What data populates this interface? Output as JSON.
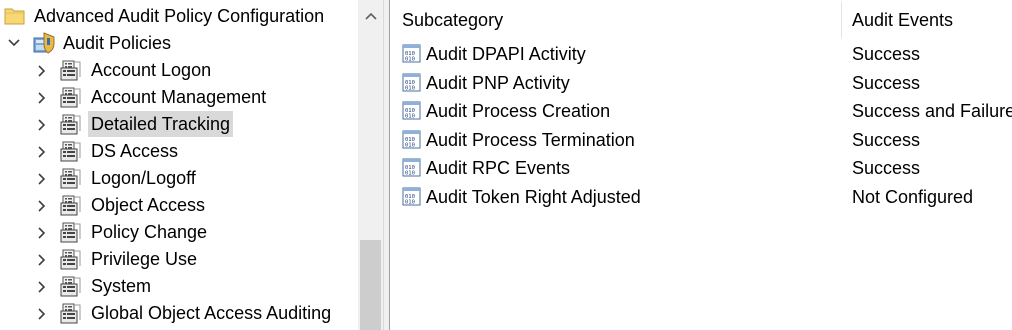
{
  "tree": {
    "root": {
      "label": "Advanced Audit Policy Configuration",
      "icon": "folder-icon"
    },
    "audit_policies": {
      "label": "Audit Policies",
      "icon": "audit-policy-icon",
      "expanded": true
    },
    "items": [
      {
        "label": "Account Logon",
        "icon": "policy-category-icon",
        "selected": false
      },
      {
        "label": "Account Management",
        "icon": "policy-category-icon",
        "selected": false
      },
      {
        "label": "Detailed Tracking",
        "icon": "policy-category-icon",
        "selected": true
      },
      {
        "label": "DS Access",
        "icon": "policy-category-icon",
        "selected": false
      },
      {
        "label": "Logon/Logoff",
        "icon": "policy-category-icon",
        "selected": false
      },
      {
        "label": "Object Access",
        "icon": "policy-category-icon",
        "selected": false
      },
      {
        "label": "Policy Change",
        "icon": "policy-category-icon",
        "selected": false
      },
      {
        "label": "Privilege Use",
        "icon": "policy-category-icon",
        "selected": false
      },
      {
        "label": "System",
        "icon": "policy-category-icon",
        "selected": false
      },
      {
        "label": "Global Object Access Auditing",
        "icon": "policy-category-icon",
        "selected": false
      }
    ]
  },
  "list": {
    "columns": {
      "subcategory": "Subcategory",
      "audit_events": "Audit Events"
    },
    "rows": [
      {
        "name": "Audit DPAPI Activity",
        "value": "Success"
      },
      {
        "name": "Audit PNP Activity",
        "value": "Success"
      },
      {
        "name": "Audit Process Creation",
        "value": "Success and Failure"
      },
      {
        "name": "Audit Process Termination",
        "value": "Success"
      },
      {
        "name": "Audit RPC Events",
        "value": "Success"
      },
      {
        "name": "Audit Token Right Adjusted",
        "value": "Not Configured"
      }
    ]
  },
  "colors": {
    "selection": "#d9d9d9",
    "pane_background": "#ffffff",
    "scrollbar": "#f0f0f0"
  }
}
